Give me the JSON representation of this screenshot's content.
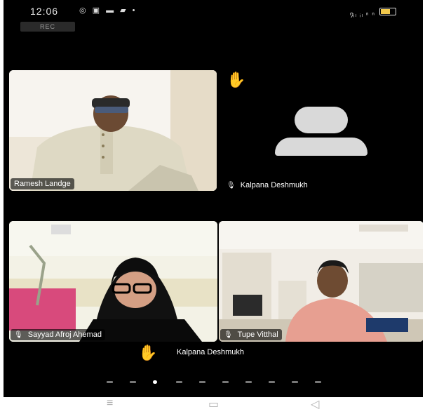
{
  "status_bar": {
    "time": "12:06",
    "left_icons": "◎ ▣ ▬ ▰ •",
    "right_icons": "᠀ᵢₗ ᵢₗ ⁿ ⁿ"
  },
  "recording": {
    "label": "REC"
  },
  "participants": [
    {
      "name": "Ramesh Landge",
      "video": true,
      "hand_raised": false
    },
    {
      "name": "Kalpana Deshmukh",
      "video": false,
      "hand_raised": true,
      "muted": true
    },
    {
      "name": "Sayyad Afroj Ahemad",
      "video": true,
      "muted": true
    },
    {
      "name": "Tupe Vitthal",
      "video": true,
      "muted": true
    }
  ],
  "raised_hand_bar": {
    "name": "Kalpana Deshmukh"
  },
  "icons": {
    "hand": "raised-hand-icon",
    "mic_off": "mic-off-icon",
    "avatar": "avatar-placeholder-icon"
  },
  "colors": {
    "background": "#000000",
    "hand": "#f5b700",
    "name_tag_bg": "#000000"
  },
  "pagination": {
    "total": 10,
    "current": 3
  },
  "navigation": {
    "menu": "≡",
    "home": "▭",
    "back": "◁"
  }
}
